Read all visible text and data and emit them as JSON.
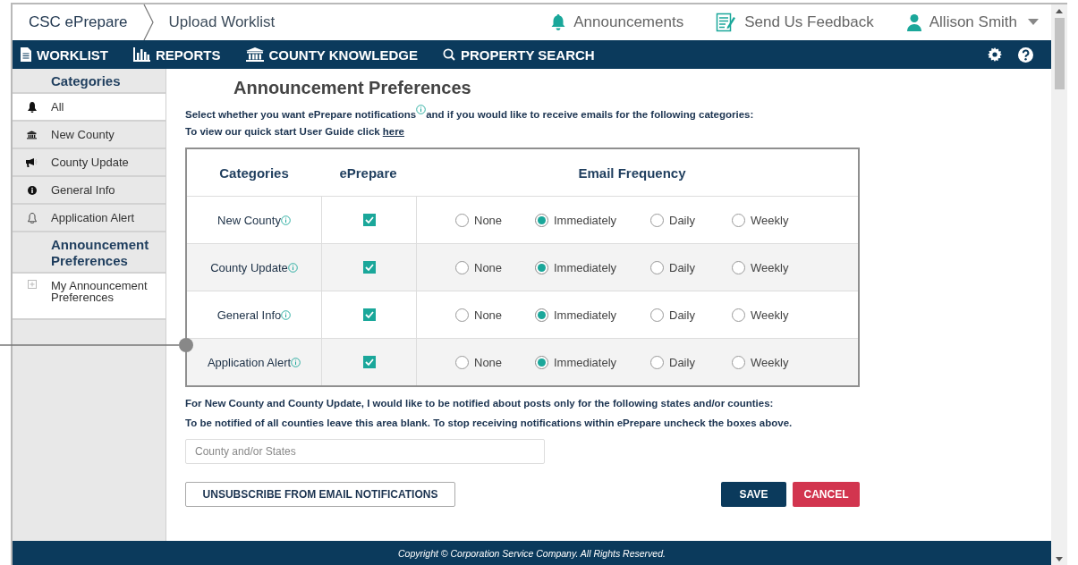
{
  "header": {
    "brand": "CSC ePrepare",
    "breadcrumb": "Upload Worklist",
    "links": [
      {
        "label": "Announcements"
      },
      {
        "label": "Send Us Feedback"
      }
    ],
    "user": "Allison Smith"
  },
  "nav": {
    "items": [
      {
        "label": "WORKLIST"
      },
      {
        "label": "REPORTS"
      },
      {
        "label": "COUNTY KNOWLEDGE"
      },
      {
        "label": "PROPERTY SEARCH"
      }
    ]
  },
  "sidebar": {
    "sections": [
      {
        "heading": "Categories",
        "items": [
          {
            "label": "All",
            "selected": true
          },
          {
            "label": "New County",
            "selected": false
          },
          {
            "label": "County Update",
            "selected": false
          },
          {
            "label": "General Info",
            "selected": false
          },
          {
            "label": "Application Alert",
            "selected": false
          }
        ]
      },
      {
        "heading": "Announcement Preferences",
        "items": [
          {
            "label": "My Announcement Preferences",
            "selected": true
          }
        ]
      }
    ]
  },
  "content": {
    "title": "Announcement Preferences",
    "intro": [
      "Select whether you want ePrepare notifications",
      "and if you would like to receive emails for the following categories:"
    ],
    "guide": {
      "text": "To view our quick start User Guide click",
      "link": "here"
    },
    "table": {
      "columns": [
        "Categories",
        "ePrepare",
        "Email Frequency"
      ],
      "rows": [
        {
          "name": "New County",
          "eprepare": true,
          "options": [
            {
              "label": "None",
              "selected": false
            },
            {
              "label": "Immediately",
              "selected": true
            },
            {
              "label": "Daily",
              "selected": false
            },
            {
              "label": "Weekly",
              "selected": false
            }
          ]
        },
        {
          "name": "County Update",
          "eprepare": true,
          "options": [
            {
              "label": "None",
              "selected": false
            },
            {
              "label": "Immediately",
              "selected": true
            },
            {
              "label": "Daily",
              "selected": false
            },
            {
              "label": "Weekly",
              "selected": false
            }
          ]
        },
        {
          "name": "General Info",
          "eprepare": true,
          "options": [
            {
              "label": "None",
              "selected": false
            },
            {
              "label": "Immediately",
              "selected": true
            },
            {
              "label": "Daily",
              "selected": false
            },
            {
              "label": "Weekly",
              "selected": false
            }
          ]
        },
        {
          "name": "Application Alert",
          "eprepare": true,
          "options": [
            {
              "label": "None",
              "selected": false
            },
            {
              "label": "Immediately",
              "selected": true
            },
            {
              "label": "Daily",
              "selected": false
            },
            {
              "label": "Weekly",
              "selected": false
            }
          ]
        }
      ]
    },
    "notes": [
      "For New County and County Update, I would like to be notified about posts only for the following states and/or counties:",
      "To be notified of all counties leave this area blank. To stop receiving notifications within ePrepare uncheck the boxes above."
    ],
    "filter": {
      "placeholder": "County and/or States"
    },
    "unsubscribe": "UNSUBSCRIBE FROM EMAIL NOTIFICATIONS",
    "save": "SAVE",
    "cancel": "CANCEL"
  },
  "footer": "Copyright © Corporation Service Company. All Rights Reserved."
}
